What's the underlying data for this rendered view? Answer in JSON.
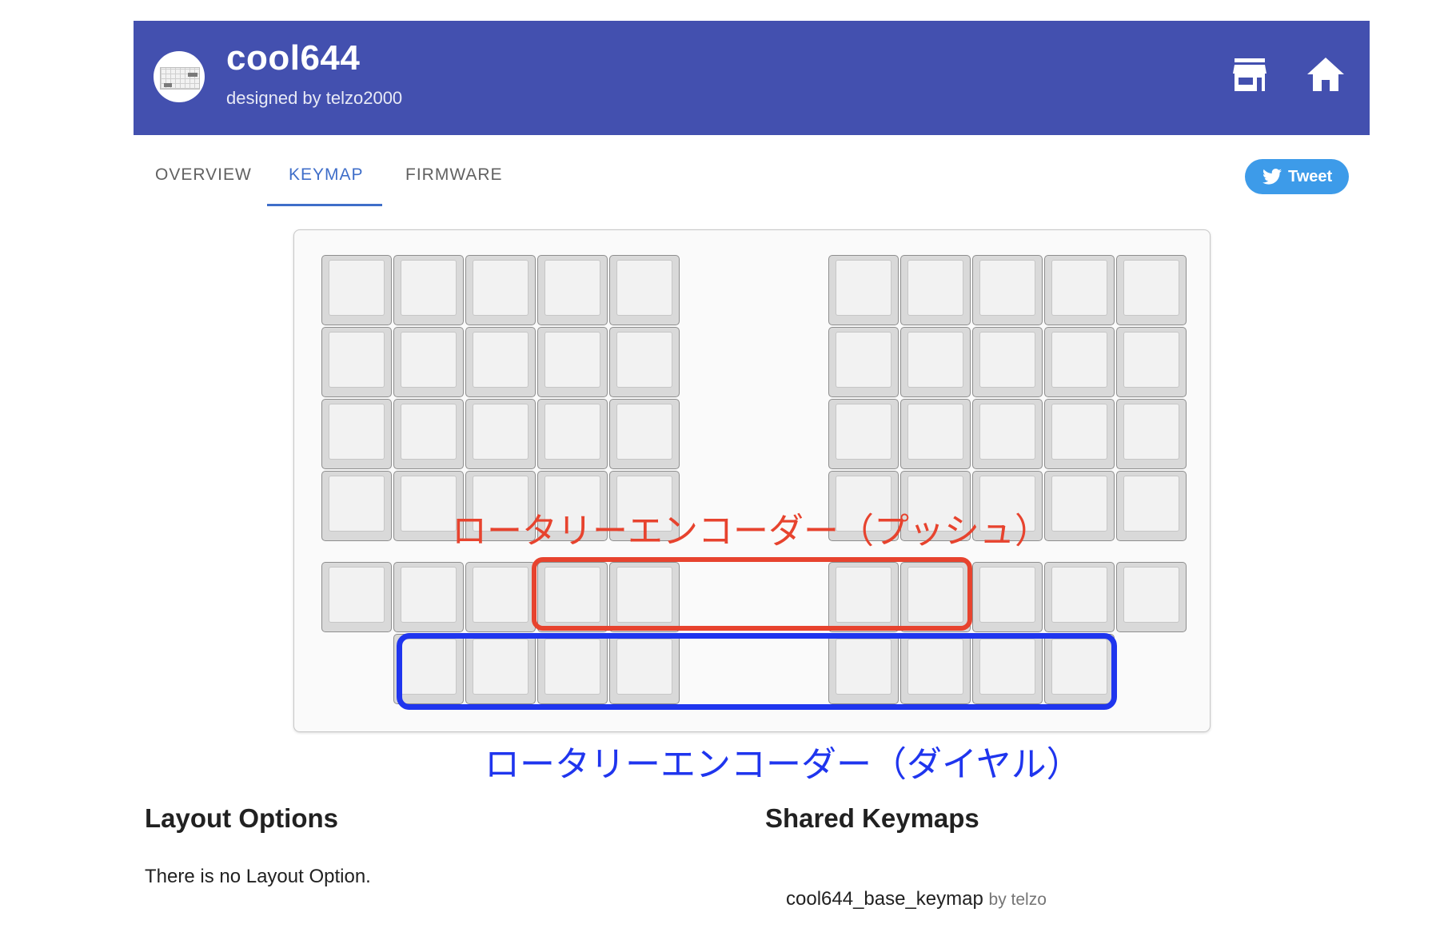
{
  "header": {
    "title": "cool644",
    "subtitle": "designed by telzo2000",
    "avatar_icon": "keyboard-avatar-icon",
    "actions": [
      {
        "name": "store-icon"
      },
      {
        "name": "home-icon"
      }
    ],
    "color": "#4350af"
  },
  "tabs": [
    {
      "label": "OVERVIEW",
      "active": false
    },
    {
      "label": "KEYMAP",
      "active": true
    },
    {
      "label": "FIRMWARE",
      "active": false
    }
  ],
  "tweet": {
    "label": "Tweet",
    "icon": "twitter-bird-icon",
    "color": "#3d9be9"
  },
  "keyboard": {
    "left_rows": [
      5,
      5,
      5,
      5,
      5,
      4
    ],
    "right_rows": [
      5,
      5,
      5,
      5,
      5,
      4
    ],
    "encoder_push_label": "ロータリーエンコーダー（プッシュ）",
    "encoder_dial_label": "ロータリーエンコーダー（ダイヤル）",
    "push_color": "#e7432e",
    "dial_color": "#1f35ee"
  },
  "layout_options": {
    "heading": "Layout Options",
    "text": "There is no Layout Option."
  },
  "shared_keymaps": {
    "heading": "Shared Keymaps",
    "items": [
      {
        "name": "cool644_base_keymap",
        "by": "by telzo"
      }
    ]
  }
}
